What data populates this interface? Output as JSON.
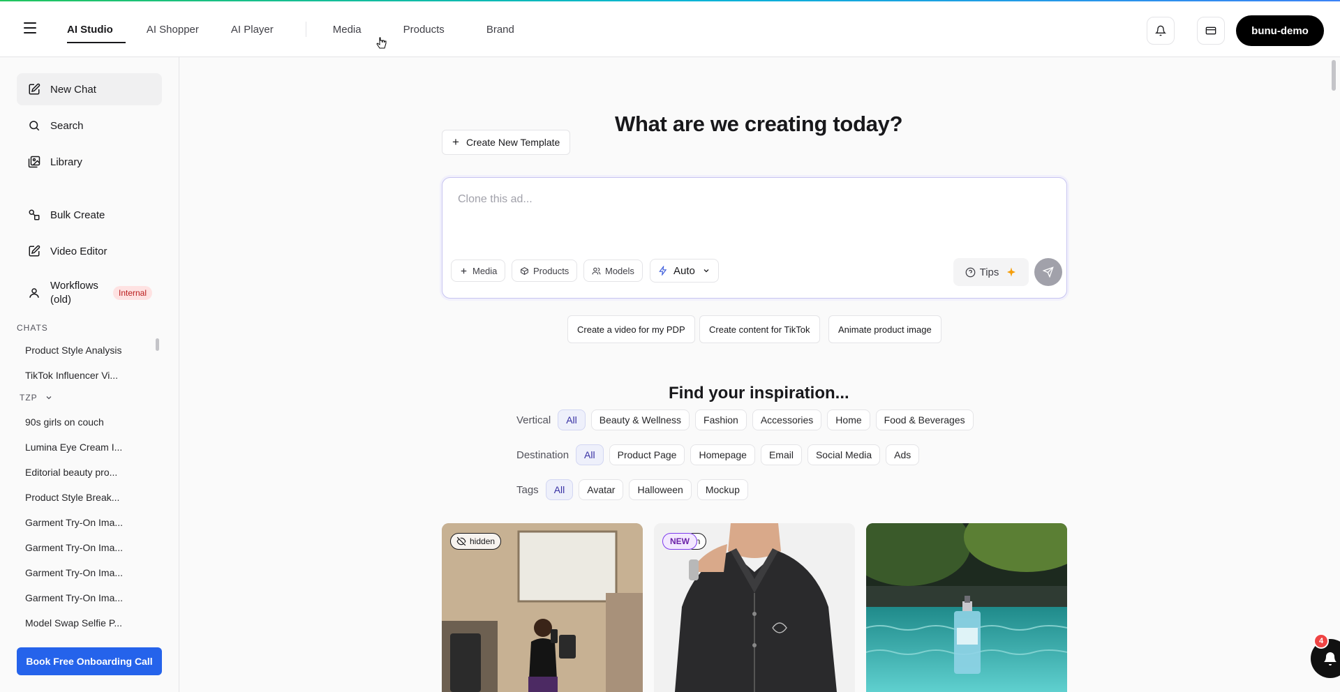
{
  "nav": {
    "tabs": [
      "AI Studio",
      "AI Shopper",
      "AI Player"
    ],
    "links": [
      "Media",
      "Products",
      "Brand"
    ],
    "user": "bunu-demo"
  },
  "sidebar": {
    "items": [
      "New Chat",
      "Search",
      "Library",
      "Bulk Create",
      "Video Editor",
      "Workflows (old)"
    ],
    "internal_badge": "Internal",
    "chats_heading": "CHATS",
    "chats": [
      "Product Style Analysis",
      "TikTok Influencer Vi..."
    ],
    "group_heading": "TZP",
    "group_chats": [
      "90s girls on couch",
      "Lumina Eye Cream I...",
      "Editorial beauty pro...",
      "Product Style Break...",
      "Garment Try-On Ima...",
      "Garment Try-On Ima...",
      "Garment Try-On Ima...",
      "Garment Try-On Ima...",
      "Model Swap Selfie P..."
    ],
    "book_call": "Book Free Onboarding Call"
  },
  "main": {
    "title": "What are we creating today?",
    "create_template": "Create New Template",
    "prompt_placeholder": "Clone this ad...",
    "chips": [
      "Media",
      "Products",
      "Models"
    ],
    "mode": "Auto",
    "tips": "Tips",
    "suggestions": [
      "Create a video for my PDP",
      "Create content for TikTok",
      "Animate product image"
    ],
    "inspiration_title": "Find your inspiration...",
    "filters": {
      "vertical_label": "Vertical",
      "vertical": [
        "All",
        "Beauty & Wellness",
        "Fashion",
        "Accessories",
        "Home",
        "Food & Beverages"
      ],
      "destination_label": "Destination",
      "destination": [
        "All",
        "Product Page",
        "Homepage",
        "Email",
        "Social Media",
        "Ads"
      ],
      "tags_label": "Tags",
      "tags": [
        "All",
        "Avatar",
        "Halloween",
        "Mockup"
      ]
    },
    "cards": {
      "card1_tag": "hidden",
      "card2_tag": "NEW",
      "card2_tag_behind": "en"
    }
  },
  "help_badge_count": "4"
}
